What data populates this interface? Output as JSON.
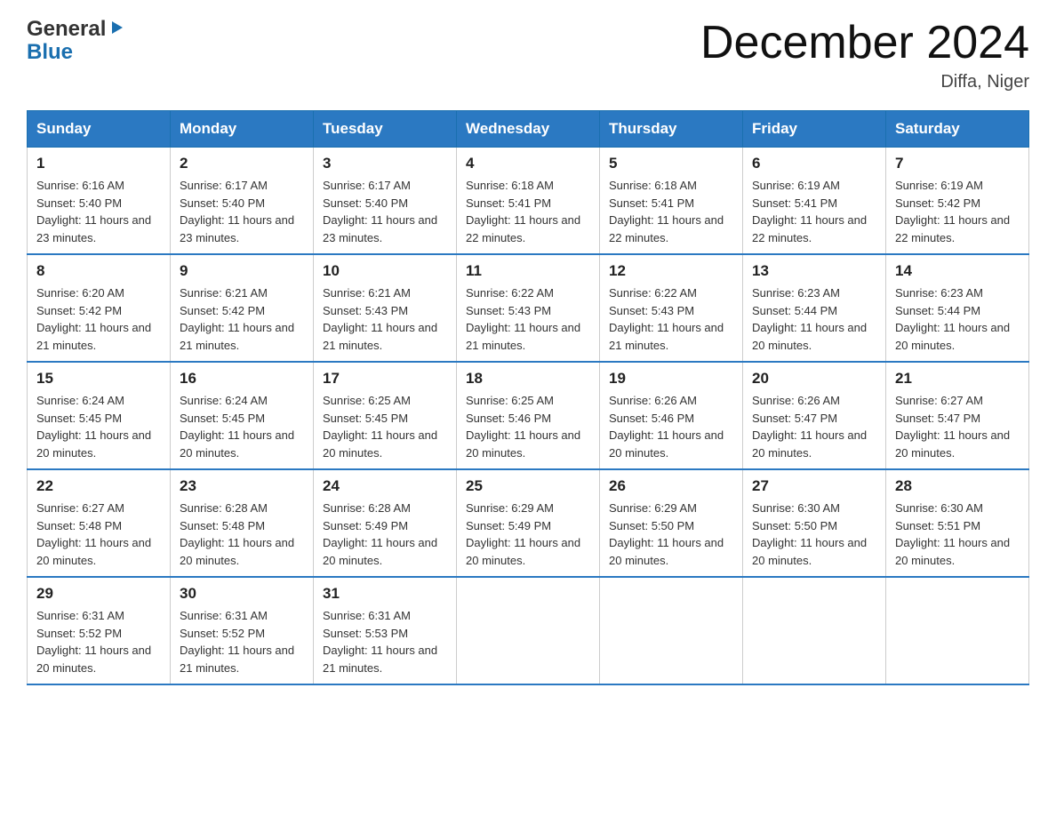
{
  "logo": {
    "line1": "General",
    "triangle": "▶",
    "line2": "Blue"
  },
  "title": "December 2024",
  "location": "Diffa, Niger",
  "days_of_week": [
    "Sunday",
    "Monday",
    "Tuesday",
    "Wednesday",
    "Thursday",
    "Friday",
    "Saturday"
  ],
  "weeks": [
    [
      {
        "day": "1",
        "sunrise": "6:16 AM",
        "sunset": "5:40 PM",
        "daylight": "11 hours and 23 minutes."
      },
      {
        "day": "2",
        "sunrise": "6:17 AM",
        "sunset": "5:40 PM",
        "daylight": "11 hours and 23 minutes."
      },
      {
        "day": "3",
        "sunrise": "6:17 AM",
        "sunset": "5:40 PM",
        "daylight": "11 hours and 23 minutes."
      },
      {
        "day": "4",
        "sunrise": "6:18 AM",
        "sunset": "5:41 PM",
        "daylight": "11 hours and 22 minutes."
      },
      {
        "day": "5",
        "sunrise": "6:18 AM",
        "sunset": "5:41 PM",
        "daylight": "11 hours and 22 minutes."
      },
      {
        "day": "6",
        "sunrise": "6:19 AM",
        "sunset": "5:41 PM",
        "daylight": "11 hours and 22 minutes."
      },
      {
        "day": "7",
        "sunrise": "6:19 AM",
        "sunset": "5:42 PM",
        "daylight": "11 hours and 22 minutes."
      }
    ],
    [
      {
        "day": "8",
        "sunrise": "6:20 AM",
        "sunset": "5:42 PM",
        "daylight": "11 hours and 21 minutes."
      },
      {
        "day": "9",
        "sunrise": "6:21 AM",
        "sunset": "5:42 PM",
        "daylight": "11 hours and 21 minutes."
      },
      {
        "day": "10",
        "sunrise": "6:21 AM",
        "sunset": "5:43 PM",
        "daylight": "11 hours and 21 minutes."
      },
      {
        "day": "11",
        "sunrise": "6:22 AM",
        "sunset": "5:43 PM",
        "daylight": "11 hours and 21 minutes."
      },
      {
        "day": "12",
        "sunrise": "6:22 AM",
        "sunset": "5:43 PM",
        "daylight": "11 hours and 21 minutes."
      },
      {
        "day": "13",
        "sunrise": "6:23 AM",
        "sunset": "5:44 PM",
        "daylight": "11 hours and 20 minutes."
      },
      {
        "day": "14",
        "sunrise": "6:23 AM",
        "sunset": "5:44 PM",
        "daylight": "11 hours and 20 minutes."
      }
    ],
    [
      {
        "day": "15",
        "sunrise": "6:24 AM",
        "sunset": "5:45 PM",
        "daylight": "11 hours and 20 minutes."
      },
      {
        "day": "16",
        "sunrise": "6:24 AM",
        "sunset": "5:45 PM",
        "daylight": "11 hours and 20 minutes."
      },
      {
        "day": "17",
        "sunrise": "6:25 AM",
        "sunset": "5:45 PM",
        "daylight": "11 hours and 20 minutes."
      },
      {
        "day": "18",
        "sunrise": "6:25 AM",
        "sunset": "5:46 PM",
        "daylight": "11 hours and 20 minutes."
      },
      {
        "day": "19",
        "sunrise": "6:26 AM",
        "sunset": "5:46 PM",
        "daylight": "11 hours and 20 minutes."
      },
      {
        "day": "20",
        "sunrise": "6:26 AM",
        "sunset": "5:47 PM",
        "daylight": "11 hours and 20 minutes."
      },
      {
        "day": "21",
        "sunrise": "6:27 AM",
        "sunset": "5:47 PM",
        "daylight": "11 hours and 20 minutes."
      }
    ],
    [
      {
        "day": "22",
        "sunrise": "6:27 AM",
        "sunset": "5:48 PM",
        "daylight": "11 hours and 20 minutes."
      },
      {
        "day": "23",
        "sunrise": "6:28 AM",
        "sunset": "5:48 PM",
        "daylight": "11 hours and 20 minutes."
      },
      {
        "day": "24",
        "sunrise": "6:28 AM",
        "sunset": "5:49 PM",
        "daylight": "11 hours and 20 minutes."
      },
      {
        "day": "25",
        "sunrise": "6:29 AM",
        "sunset": "5:49 PM",
        "daylight": "11 hours and 20 minutes."
      },
      {
        "day": "26",
        "sunrise": "6:29 AM",
        "sunset": "5:50 PM",
        "daylight": "11 hours and 20 minutes."
      },
      {
        "day": "27",
        "sunrise": "6:30 AM",
        "sunset": "5:50 PM",
        "daylight": "11 hours and 20 minutes."
      },
      {
        "day": "28",
        "sunrise": "6:30 AM",
        "sunset": "5:51 PM",
        "daylight": "11 hours and 20 minutes."
      }
    ],
    [
      {
        "day": "29",
        "sunrise": "6:31 AM",
        "sunset": "5:52 PM",
        "daylight": "11 hours and 20 minutes."
      },
      {
        "day": "30",
        "sunrise": "6:31 AM",
        "sunset": "5:52 PM",
        "daylight": "11 hours and 21 minutes."
      },
      {
        "day": "31",
        "sunrise": "6:31 AM",
        "sunset": "5:53 PM",
        "daylight": "11 hours and 21 minutes."
      },
      null,
      null,
      null,
      null
    ]
  ]
}
